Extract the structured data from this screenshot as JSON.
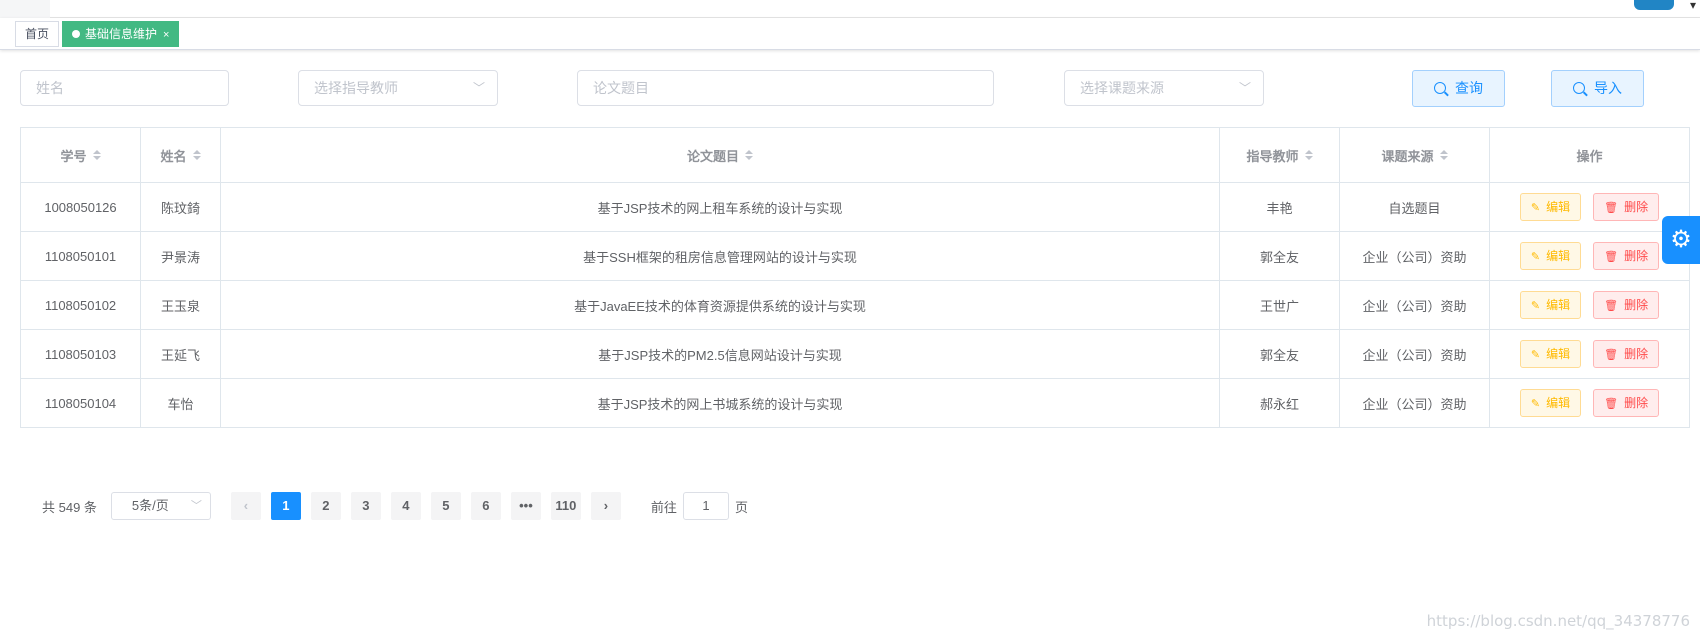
{
  "tags": {
    "home": "首页",
    "active": "基础信息维护",
    "close": "×"
  },
  "filters": {
    "name_placeholder": "姓名",
    "teacher_placeholder": "选择指导教师",
    "title_placeholder": "论文题目",
    "source_placeholder": "选择课题来源",
    "query_label": "查询",
    "import_label": "导入"
  },
  "table": {
    "headers": [
      "学号",
      "姓名",
      "论文题目",
      "指导教师",
      "课题来源",
      "操作"
    ],
    "edit_label": "编辑",
    "delete_label": "删除",
    "rows": [
      {
        "id": "1008050126",
        "name": "陈玟錡",
        "title": "基于JSP技术的网上租车系统的设计与实现",
        "teacher": "丰艳",
        "source": "自选题目"
      },
      {
        "id": "1108050101",
        "name": "尹景涛",
        "title": "基于SSH框架的租房信息管理网站的设计与实现",
        "teacher": "郭全友",
        "source": "企业（公司）资助"
      },
      {
        "id": "1108050102",
        "name": "王玉泉",
        "title": "基于JavaEE技术的体育资源提供系统的设计与实现",
        "teacher": "王世广",
        "source": "企业（公司）资助"
      },
      {
        "id": "1108050103",
        "name": "王延飞",
        "title": "基于JSP技术的PM2.5信息网站设计与实现",
        "teacher": "郭全友",
        "source": "企业（公司）资助"
      },
      {
        "id": "1108050104",
        "name": "车怡",
        "title": "基于JSP技术的网上书城系统的设计与实现",
        "teacher": "郝永红",
        "source": "企业（公司）资助"
      }
    ]
  },
  "pagination": {
    "total": "共 549 条",
    "page_size": "5条/页",
    "pages": [
      "1",
      "2",
      "3",
      "4",
      "5",
      "6",
      "•••",
      "110"
    ],
    "current": "1",
    "goto_prefix": "前往",
    "goto_value": "1",
    "goto_suffix": "页"
  },
  "watermark": "https://blog.csdn.net/qq_34378776",
  "colors": {
    "primary": "#1890ff",
    "tag_active": "#42b983",
    "edit": "#ffba00",
    "delete": "#ff4949"
  }
}
